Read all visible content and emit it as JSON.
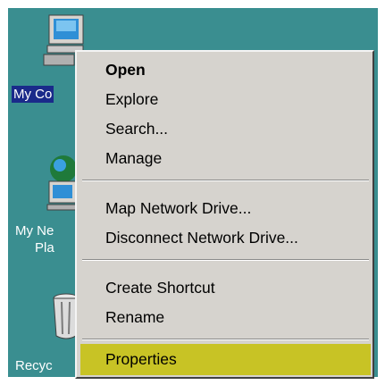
{
  "desktop": {
    "icons": [
      {
        "name": "my-computer",
        "label": "My Co",
        "selected": true
      },
      {
        "name": "my-network-places",
        "label_line1": "My Ne",
        "label_line2": "Pla"
      },
      {
        "name": "recycle-bin",
        "label": "Recyc"
      }
    ]
  },
  "context_menu": {
    "items": [
      {
        "label": "Open",
        "bold": true
      },
      {
        "label": "Explore"
      },
      {
        "label": "Search..."
      },
      {
        "label": "Manage"
      },
      {
        "label": "Map Network Drive..."
      },
      {
        "label": "Disconnect Network Drive..."
      },
      {
        "label": "Create Shortcut"
      },
      {
        "label": "Rename"
      },
      {
        "label": "Properties",
        "highlighted": true
      }
    ]
  },
  "colors": {
    "desktop": "#3a8e90",
    "menu_bg": "#d6d3ce",
    "highlight": "#c8c325",
    "selection": "#1a2a8a"
  }
}
